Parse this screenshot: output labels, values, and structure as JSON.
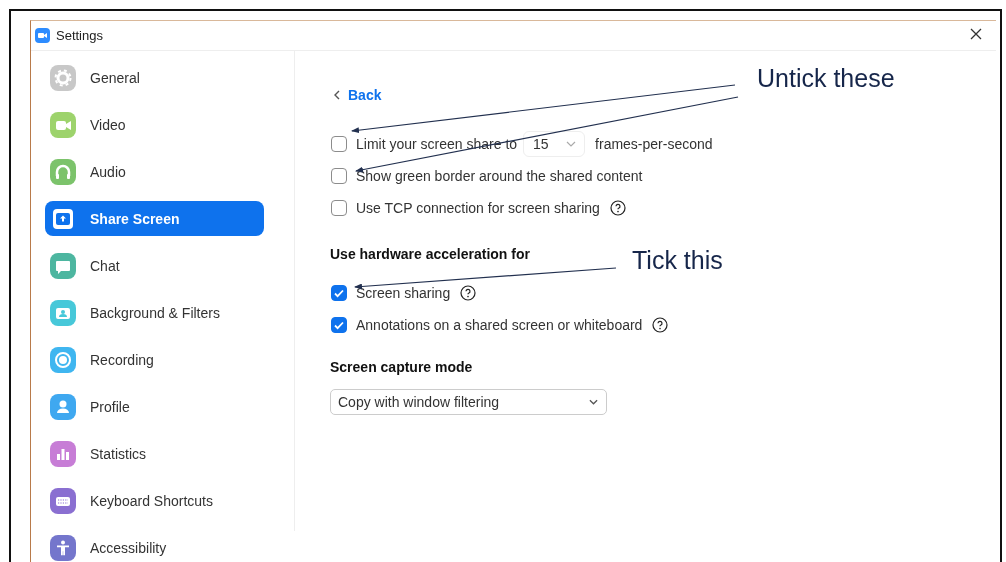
{
  "window": {
    "title": "Settings"
  },
  "sidebar": {
    "items": [
      {
        "label": "General",
        "selected": false
      },
      {
        "label": "Video",
        "selected": false
      },
      {
        "label": "Audio",
        "selected": false
      },
      {
        "label": "Share Screen",
        "selected": true
      },
      {
        "label": "Chat",
        "selected": false
      },
      {
        "label": "Background & Filters",
        "selected": false
      },
      {
        "label": "Recording",
        "selected": false
      },
      {
        "label": "Profile",
        "selected": false
      },
      {
        "label": "Statistics",
        "selected": false
      },
      {
        "label": "Keyboard Shortcuts",
        "selected": false
      },
      {
        "label": "Accessibility",
        "selected": false
      }
    ]
  },
  "content": {
    "back": "Back",
    "options": [
      {
        "kind": "fps",
        "label": "Limit your screen share to",
        "checked": false,
        "select_value": "15",
        "suffix": "frames-per-second"
      },
      {
        "kind": "plain",
        "label": "Show green border around the shared content",
        "checked": false,
        "help": false
      },
      {
        "kind": "plain",
        "label": "Use TCP connection for screen sharing",
        "checked": false,
        "help": true
      }
    ],
    "hardware_heading": "Use hardware acceleration for",
    "hardware_options": [
      {
        "kind": "plain",
        "label": "Screen sharing",
        "checked": true,
        "help": true
      },
      {
        "kind": "plain",
        "label": "Annotations on a shared screen or whiteboard",
        "checked": true,
        "help": true
      }
    ],
    "capture_heading": "Screen capture mode",
    "capture_mode": {
      "value": "Copy with window filtering"
    }
  },
  "annotations": [
    {
      "text": "Untick these"
    },
    {
      "text": "Tick this"
    }
  ]
}
